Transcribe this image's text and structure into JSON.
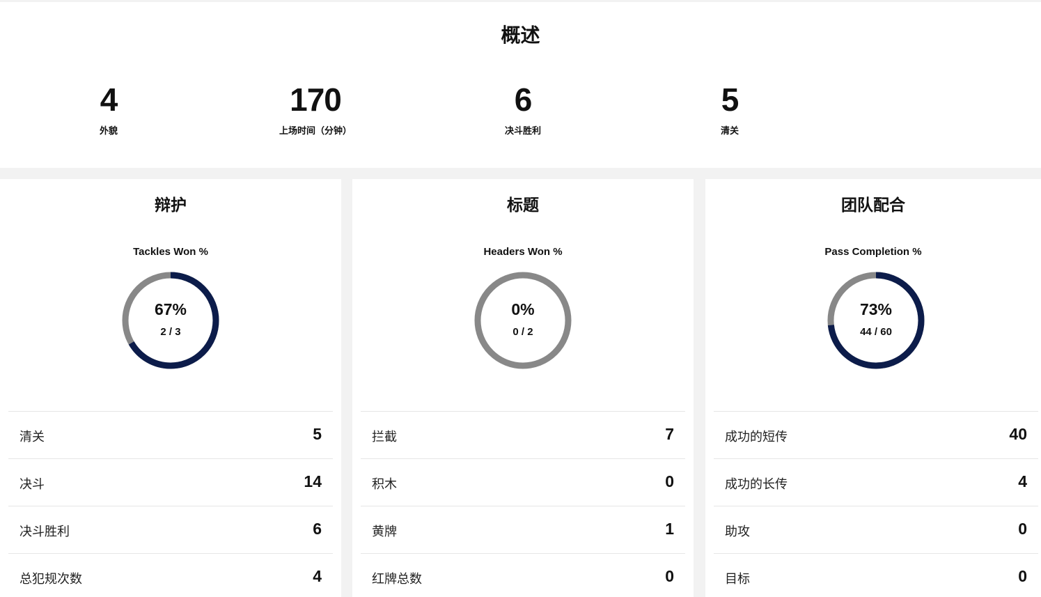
{
  "overview": {
    "title": "概述",
    "stats": [
      {
        "value": "4",
        "label": "外貌"
      },
      {
        "value": "170",
        "label": "上场时间（分钟）"
      },
      {
        "value": "6",
        "label": "决斗胜利"
      },
      {
        "value": "5",
        "label": "清关"
      }
    ]
  },
  "panels": [
    {
      "title": "辩护",
      "gauge": {
        "label": "Tackles Won %",
        "percent_text": "67%",
        "fraction_text": "2 / 3",
        "fraction": 0.6667
      },
      "rows": [
        {
          "label": "清关",
          "value": "5"
        },
        {
          "label": "决斗",
          "value": "14"
        },
        {
          "label": "决斗胜利",
          "value": "6"
        },
        {
          "label": "总犯规次数",
          "value": "4"
        }
      ]
    },
    {
      "title": "标题",
      "gauge": {
        "label": "Headers Won %",
        "percent_text": "0%",
        "fraction_text": "0 / 2",
        "fraction": 0
      },
      "rows": [
        {
          "label": "拦截",
          "value": "7"
        },
        {
          "label": "积木",
          "value": "0"
        },
        {
          "label": "黄牌",
          "value": "1"
        },
        {
          "label": "红牌总数",
          "value": "0"
        }
      ]
    },
    {
      "title": "团队配合",
      "gauge": {
        "label": "Pass Completion %",
        "percent_text": "73%",
        "fraction_text": "44 / 60",
        "fraction": 0.7333
      },
      "rows": [
        {
          "label": "成功的短传",
          "value": "40"
        },
        {
          "label": "成功的长传",
          "value": "4"
        },
        {
          "label": "助攻",
          "value": "0"
        },
        {
          "label": "目标",
          "value": "0"
        }
      ]
    }
  ],
  "colors": {
    "accent": "#0c1c4a",
    "track": "#888888",
    "background": "#f2f2f2"
  }
}
